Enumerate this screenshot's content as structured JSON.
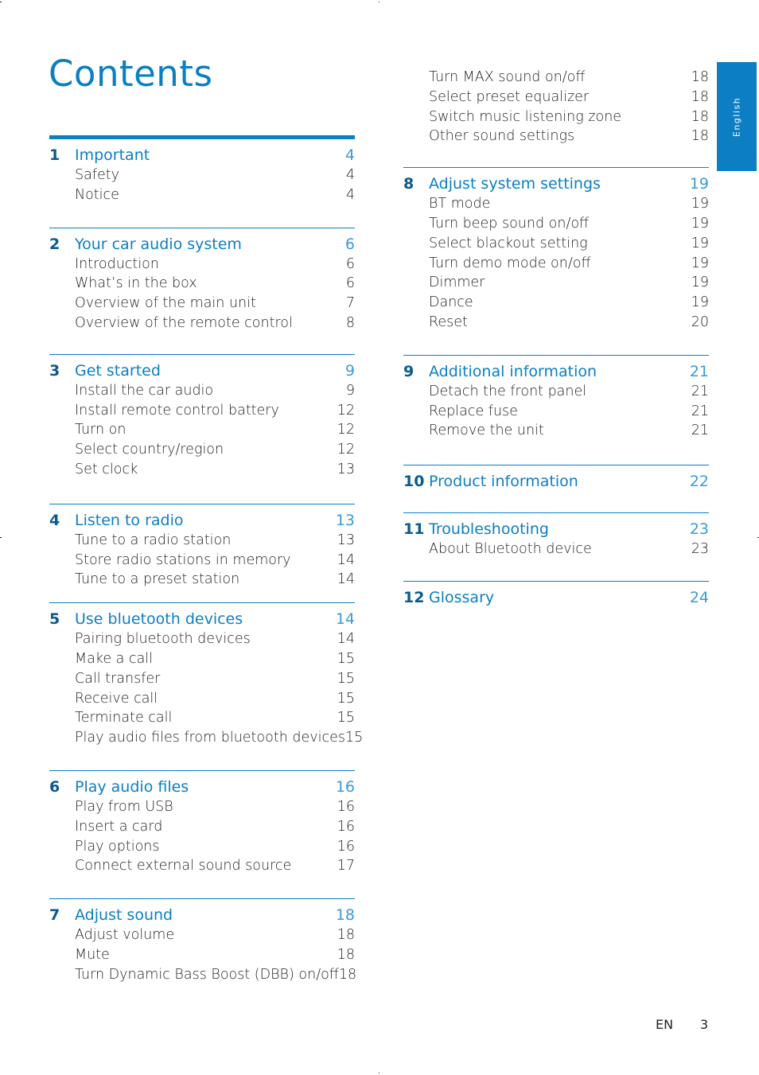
{
  "page_title": "Contents",
  "language_tab": "English",
  "colors": {
    "accent": "#0b7ec4",
    "number": "#0a5a8f",
    "text": "#231f20"
  },
  "left_column": [
    {
      "num": "1",
      "title": "Important",
      "page": "4",
      "items": [
        {
          "label": "Safety",
          "page": "4"
        },
        {
          "label": "Notice",
          "page": "4"
        }
      ]
    },
    {
      "num": "2",
      "title": "Your car audio system",
      "page": "6",
      "items": [
        {
          "label": "Introduction",
          "page": "6"
        },
        {
          "label": "What’s in the box",
          "page": "6"
        },
        {
          "label": "Overview of the main unit",
          "page": "7"
        },
        {
          "label": "Overview of the remote control",
          "page": "8"
        }
      ]
    },
    {
      "num": "3",
      "title": "Get started",
      "page": "9",
      "items": [
        {
          "label": "Install the car audio",
          "page": "9"
        },
        {
          "label": "Install remote control battery",
          "page": "12"
        },
        {
          "label": "Turn on",
          "page": "12"
        },
        {
          "label": "Select country/region",
          "page": "12"
        },
        {
          "label": "Set clock",
          "page": "13"
        }
      ]
    },
    {
      "num": "4",
      "title": "Listen to radio",
      "page": "13",
      "items": [
        {
          "label": "Tune to a radio station",
          "page": "13"
        },
        {
          "label": "Store radio stations in memory",
          "page": "14"
        },
        {
          "label": "Tune to a preset station",
          "page": "14"
        }
      ]
    },
    {
      "num": "5",
      "title": "Use bluetooth devices",
      "page": "14",
      "items": [
        {
          "label": "Pairing bluetooth devices",
          "page": "14"
        },
        {
          "label": "Make a call",
          "page": "15"
        },
        {
          "label": "Call transfer",
          "page": "15"
        },
        {
          "label": "Receive call",
          "page": "15"
        },
        {
          "label": "Terminate call",
          "page": "15"
        },
        {
          "label": "Play audio files from bluetooth devices",
          "page": "15"
        }
      ]
    },
    {
      "num": "6",
      "title": "Play audio files",
      "page": "16",
      "items": [
        {
          "label": "Play from USB",
          "page": "16"
        },
        {
          "label": "Insert a card",
          "page": "16"
        },
        {
          "label": "Play options",
          "page": "16"
        },
        {
          "label": "Connect external sound source",
          "page": "17"
        }
      ]
    },
    {
      "num": "7",
      "title": "Adjust sound",
      "page": "18",
      "items": [
        {
          "label": "Adjust volume",
          "page": "18"
        },
        {
          "label": "Mute",
          "page": "18"
        },
        {
          "label": "Turn Dynamic Bass Boost (DBB) on/off",
          "page": "18"
        }
      ]
    }
  ],
  "right_column_continued_items": [
    {
      "label": "Turn MAX sound on/off",
      "page": "18"
    },
    {
      "label": "Select preset equalizer",
      "page": "18"
    },
    {
      "label": "Switch music listening zone",
      "page": "18"
    },
    {
      "label": "Other sound settings",
      "page": "18"
    }
  ],
  "right_column": [
    {
      "num": "8",
      "title": "Adjust system settings",
      "page": "19",
      "items": [
        {
          "label": "BT mode",
          "page": "19"
        },
        {
          "label": "Turn beep sound on/off",
          "page": "19"
        },
        {
          "label": "Select blackout setting",
          "page": "19"
        },
        {
          "label": "Turn demo mode on/off",
          "page": "19"
        },
        {
          "label": "Dimmer",
          "page": "19"
        },
        {
          "label": "Dance",
          "page": "19"
        },
        {
          "label": "Reset",
          "page": "20"
        }
      ]
    },
    {
      "num": "9",
      "title": "Additional information",
      "page": "21",
      "items": [
        {
          "label": "Detach the front panel",
          "page": "21"
        },
        {
          "label": "Replace fuse",
          "page": "21"
        },
        {
          "label": "Remove the unit",
          "page": "21"
        }
      ]
    },
    {
      "num": "10",
      "title": "Product information",
      "page": "22",
      "items": []
    },
    {
      "num": "11",
      "title": "Troubleshooting",
      "page": "23",
      "items": [
        {
          "label": "About Bluetooth device",
          "page": "23"
        }
      ]
    },
    {
      "num": "12",
      "title": "Glossary",
      "page": "24",
      "items": []
    }
  ],
  "footer": {
    "language": "EN",
    "page_number": "3"
  }
}
